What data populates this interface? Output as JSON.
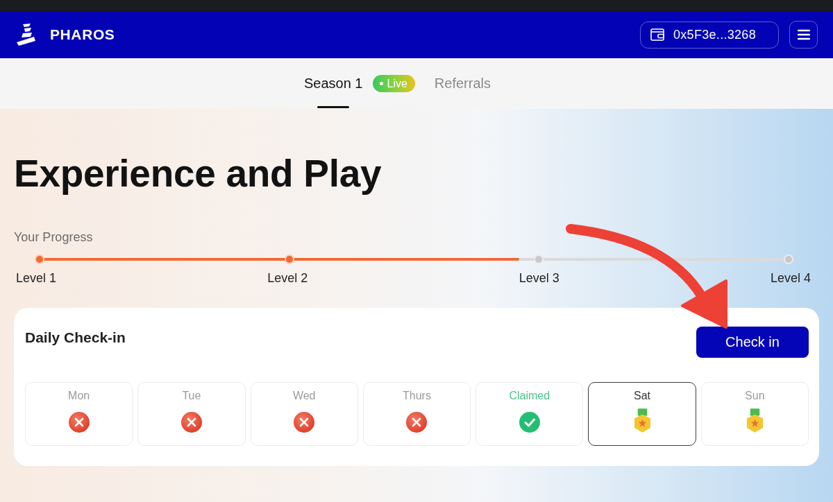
{
  "header": {
    "brand": "PHAROS",
    "wallet": "0x5F3e...3268"
  },
  "tabs": [
    {
      "label": "Season 1",
      "selected": true,
      "badge": "Live"
    },
    {
      "label": "Referrals",
      "selected": false
    }
  ],
  "title": "Experience and Play",
  "progress": {
    "label": "Your Progress",
    "level": 0.64,
    "milestones": [
      {
        "label": "Level 1",
        "reached": true
      },
      {
        "label": "Level 2",
        "reached": true
      },
      {
        "label": "Level 3",
        "reached": false
      },
      {
        "label": "Level 4",
        "reached": false
      }
    ]
  },
  "checkin": {
    "title": "Daily Check-in",
    "button": "Check in",
    "days": [
      {
        "label": "Mon",
        "kind": "missed",
        "selected": false
      },
      {
        "label": "Tue",
        "kind": "missed",
        "selected": false
      },
      {
        "label": "Wed",
        "kind": "missed",
        "selected": false
      },
      {
        "label": "Thurs",
        "kind": "missed",
        "selected": false
      },
      {
        "label": "Claimed",
        "kind": "claimed",
        "selected": false
      },
      {
        "label": "Sat",
        "kind": "reward",
        "selected": true
      },
      {
        "label": "Sun",
        "kind": "reward",
        "selected": false
      }
    ]
  }
}
